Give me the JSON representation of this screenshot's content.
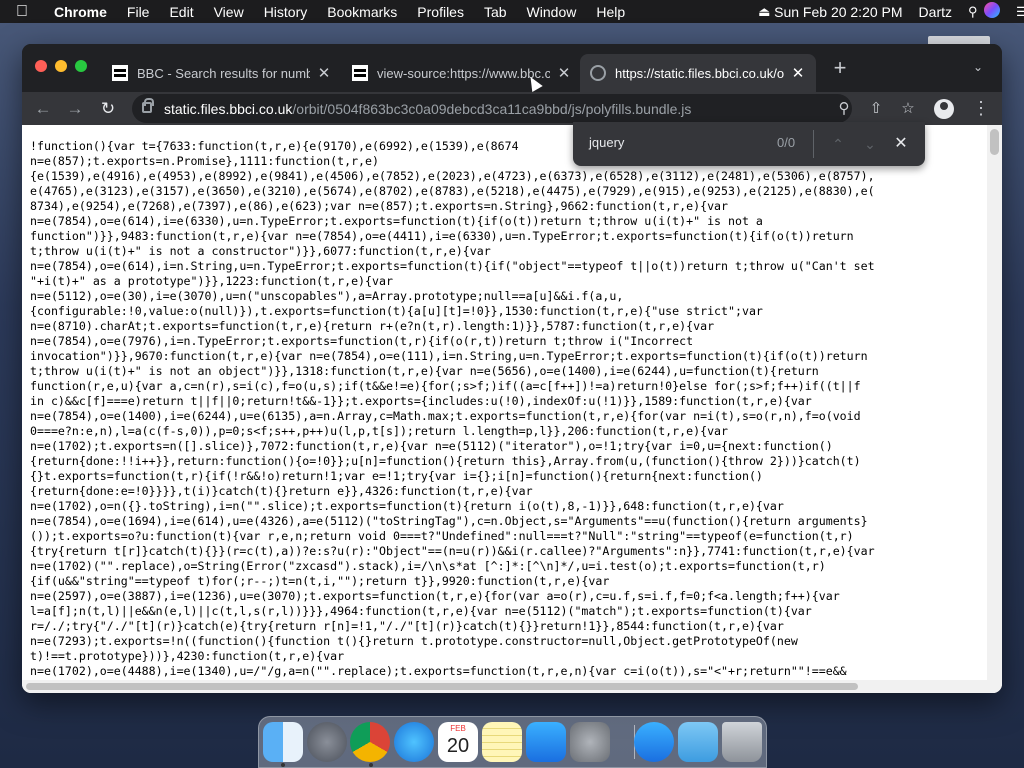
{
  "menubar": {
    "app": "Chrome",
    "items": [
      "File",
      "Edit",
      "View",
      "History",
      "Bookmarks",
      "Profiles",
      "Tab",
      "Window",
      "Help"
    ],
    "clock": "Sun Feb 20  2:20 PM",
    "user": "Dartz"
  },
  "browser": {
    "tabs": [
      {
        "title": "BBC - Search results for numbe",
        "icon": "bbc-favicon"
      },
      {
        "title": "view-source:https://www.bbc.c",
        "icon": "bbc-favicon"
      },
      {
        "title": "https://static.files.bbci.co.uk/or",
        "icon": "globe-icon"
      }
    ],
    "url_host": "static.files.bbci.co.uk",
    "url_path": "/orbit/0504f863bc3c0a09debcd3ca11ca9bbd/js/polyfills.bundle.js"
  },
  "find": {
    "query": "jquery",
    "count": "0/0"
  },
  "dock": {
    "calendar_month": "FEB",
    "calendar_day": "20"
  },
  "code_lines": [
    "!function(){var t={7633:function(t,r,e){e(9170),e(6992),e(1539),e(8674",
    "n=e(857);t.exports=n.Promise},1111:function(t,r,e)",
    "{e(1539),e(4916),e(4953),e(8992),e(9841),e(4506),e(7852),e(2023),e(4723),e(6373),e(6528),e(3112),e(2481),e(5306),e(8757),",
    "e(4765),e(3123),e(3157),e(3650),e(3210),e(5674),e(8702),e(8783),e(5218),e(4475),e(7929),e(915),e(9253),e(2125),e(8830),e(",
    "8734),e(9254),e(7268),e(7397),e(86),e(623);var n=e(857);t.exports=n.String},9662:function(t,r,e){var",
    "n=e(7854),o=e(614),i=e(6330),u=n.TypeError;t.exports=function(t){if(o(t))return t;throw u(i(t)+\" is not a",
    "function\")}},9483:function(t,r,e){var n=e(7854),o=e(4411),i=e(6330),u=n.TypeError;t.exports=function(t){if(o(t))return",
    "t;throw u(i(t)+\" is not a constructor\")}},6077:function(t,r,e){var",
    "n=e(7854),o=e(614),i=n.String,u=n.TypeError;t.exports=function(t){if(\"object\"==typeof t||o(t))return t;throw u(\"Can't set",
    "\"+i(t)+\" as a prototype\")}},1223:function(t,r,e){var",
    "n=e(5112),o=e(30),i=e(3070),u=n(\"unscopables\"),a=Array.prototype;null==a[u]&&i.f(a,u,",
    "{configurable:!0,value:o(null)}),t.exports=function(t){a[u][t]=!0}},1530:function(t,r,e){\"use strict\";var",
    "n=e(8710).charAt;t.exports=function(t,r,e){return r+(e?n(t,r).length:1)}},5787:function(t,r,e){var",
    "n=e(7854),o=e(7976),i=n.TypeError;t.exports=function(t,r){if(o(r,t))return t;throw i(\"Incorrect",
    "invocation\")}},9670:function(t,r,e){var n=e(7854),o=e(111),i=n.String,u=n.TypeError;t.exports=function(t){if(o(t))return",
    "t;throw u(i(t)+\" is not an object\")}},1318:function(t,r,e){var n=e(5656),o=e(1400),i=e(6244),u=function(t){return",
    "function(r,e,u){var a,c=n(r),s=i(c),f=o(u,s);if(t&&e!=e){for(;s>f;)if((a=c[f++])!=a)return!0}else for(;s>f;f++)if((t||f",
    "in c)&&c[f]===e)return t||f||0;return!t&&-1}};t.exports={includes:u(!0),indexOf:u(!1)}},1589:function(t,r,e){var",
    "n=e(7854),o=e(1400),i=e(6244),u=e(6135),a=n.Array,c=Math.max;t.exports=function(t,r,e){for(var n=i(t),s=o(r,n),f=o(void",
    "0===e?n:e,n),l=a(c(f-s,0)),p=0;s<f;s++,p++)u(l,p,t[s]);return l.length=p,l}},206:function(t,r,e){var",
    "n=e(1702);t.exports=n([].slice)},7072:function(t,r,e){var n=e(5112)(\"iterator\"),o=!1;try{var i=0,u={next:function()",
    "{return{done:!!i++}},return:function(){o=!0}};u[n]=function(){return this},Array.from(u,(function(){throw 2}))}catch(t)",
    "{}t.exports=function(t,r){if(!r&&!o)return!1;var e=!1;try{var i={};i[n]=function(){return{next:function()",
    "{return{done:e=!0}}}},t(i)}catch(t){}return e}},4326:function(t,r,e){var",
    "n=e(1702),o=n({}.toString),i=n(\"\".slice);t.exports=function(t){return i(o(t),8,-1)}},648:function(t,r,e){var",
    "n=e(7854),o=e(1694),i=e(614),u=e(4326),a=e(5112)(\"toStringTag\"),c=n.Object,s=\"Arguments\"==u(function(){return arguments}",
    "());t.exports=o?u:function(t){var r,e,n;return void 0===t?\"Undefined\":null===t?\"Null\":\"string\"==typeof(e=function(t,r)",
    "{try{return t[r]}catch(t){}}(r=c(t),a))?e:s?u(r):\"Object\"==(n=u(r))&&i(r.callee)?\"Arguments\":n}},7741:function(t,r,e){var",
    "n=e(1702)(\"\".replace),o=String(Error(\"zxcasd\").stack),i=/\\n\\s*at [^:]*:[^\\n]*/,u=i.test(o);t.exports=function(t,r)",
    "{if(u&&\"string\"==typeof t)for(;r--;)t=n(t,i,\"\");return t}},9920:function(t,r,e){var",
    "n=e(2597),o=e(3887),i=e(1236),u=e(3070);t.exports=function(t,r,e){for(var a=o(r),c=u.f,s=i.f,f=0;f<a.length;f++){var",
    "l=a[f];n(t,l)||e&&n(e,l)||c(t,l,s(r,l))}}},4964:function(t,r,e){var n=e(5112)(\"match\");t.exports=function(t){var",
    "r=/./;try{\"/./\"[t](r)}catch(e){try{return r[n]=!1,\"/./\"[t](r)}catch(t){}}return!1}},8544:function(t,r,e){var",
    "n=e(7293);t.exports=!n((function(){function t(){}return t.prototype.constructor=null,Object.getPrototypeOf(new",
    "t)!==t.prototype}))},4230:function(t,r,e){var",
    "n=e(1702),o=e(4488),i=e(1340),u=/\"/g,a=n(\"\".replace);t.exports=function(t,r,e,n){var c=i(o(t)),s=\"<\"+r;return\"\"!==e&&"
  ]
}
